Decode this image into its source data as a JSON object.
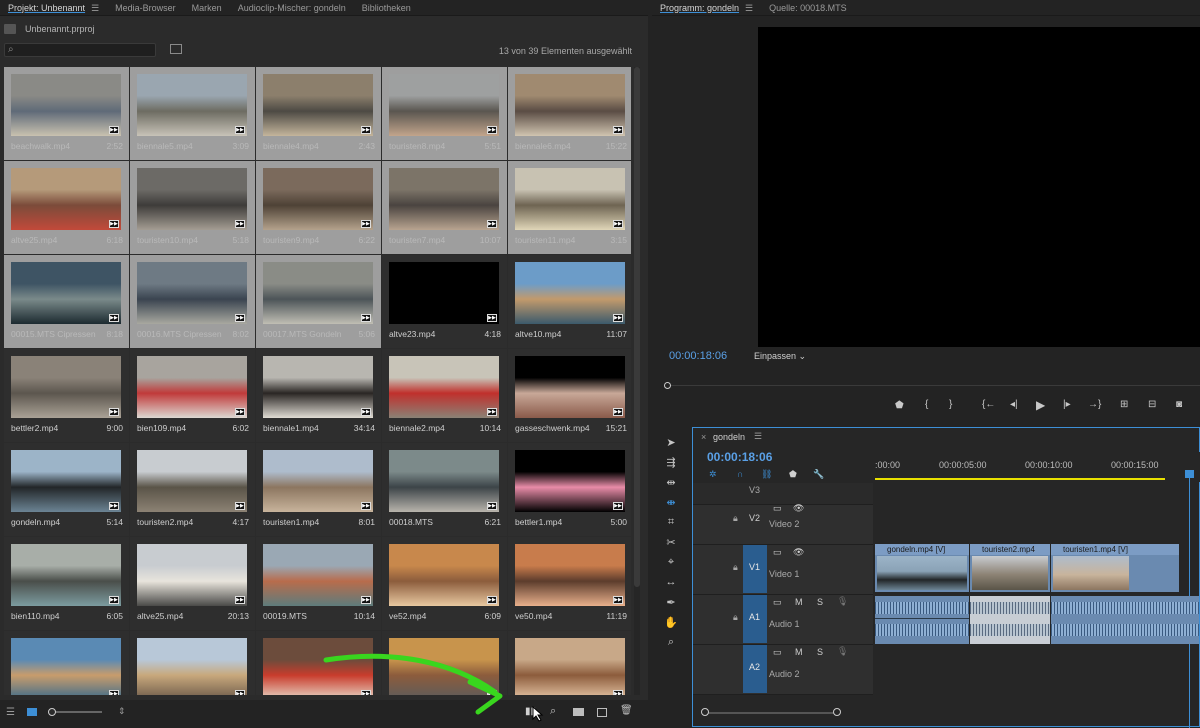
{
  "project_panel": {
    "tabs": [
      {
        "label": "Projekt: Unbenannt"
      },
      {
        "label": "Media-Browser"
      },
      {
        "label": "Marken"
      },
      {
        "label": "Audioclip-Mischer: gondeln"
      },
      {
        "label": "Bibliotheken"
      }
    ],
    "project_file": "Unbenannt.prproj",
    "search_placeholder": "",
    "selection_count": "13 von 39 Elementen ausgewählt",
    "items": [
      {
        "name": "beachwalk.mp4",
        "duration": "2:52",
        "selected": true,
        "thumb": [
          "#8a8a86",
          "#5f6a78",
          "#c9c2b0"
        ]
      },
      {
        "name": "biennale5.mp4",
        "duration": "3:09",
        "selected": true,
        "thumb": [
          "#9aa6b0",
          "#6d6c62",
          "#c8c3b8"
        ]
      },
      {
        "name": "biennale4.mp4",
        "duration": "2:43",
        "selected": true,
        "thumb": [
          "#8c7f6c",
          "#4d4a44",
          "#c4b59c"
        ]
      },
      {
        "name": "touristen8.mp4",
        "duration": "5:51",
        "selected": true,
        "thumb": [
          "#9ea0a0",
          "#5a5650",
          "#c2a58c"
        ]
      },
      {
        "name": "biennale6.mp4",
        "duration": "15:22",
        "selected": true,
        "thumb": [
          "#a08a70",
          "#5a4c44",
          "#d0c4b0"
        ]
      },
      {
        "name": "altve25.mp4",
        "duration": "6:18",
        "selected": true,
        "thumb": [
          "#b59a7a",
          "#7b4b3a",
          "#c24a3a"
        ]
      },
      {
        "name": "touristen10.mp4",
        "duration": "5:18",
        "selected": true,
        "thumb": [
          "#6c6a66",
          "#3e3c3a",
          "#a49d93"
        ]
      },
      {
        "name": "touristen9.mp4",
        "duration": "6:22",
        "selected": true,
        "thumb": [
          "#7b6a5c",
          "#4e4236",
          "#b4a28c"
        ]
      },
      {
        "name": "touristen7.mp4",
        "duration": "10:07",
        "selected": true,
        "thumb": [
          "#7c7468",
          "#4a4440",
          "#b8a490"
        ]
      },
      {
        "name": "touristen11.mp4",
        "duration": "3:15",
        "selected": true,
        "thumb": [
          "#c8c2b2",
          "#6e6452",
          "#e0d6b8"
        ]
      },
      {
        "name": "00015.MTS Cipressen",
        "duration": "8:18",
        "selected": true,
        "thumb": [
          "#3e5464",
          "#7a8a8a",
          "#1c2a30"
        ]
      },
      {
        "name": "00016.MTS Cipressen",
        "duration": "8:02",
        "selected": true,
        "thumb": [
          "#6e7a84",
          "#3a4450",
          "#a8a8a0"
        ]
      },
      {
        "name": "00017.MTS Gondeln",
        "duration": "5:06",
        "selected": true,
        "thumb": [
          "#8a8c86",
          "#4c5458",
          "#c0beb4"
        ]
      },
      {
        "name": "altve23.mp4",
        "duration": "4:18",
        "selected": false,
        "thumb": [
          "#000000",
          "#000000",
          "#000000"
        ]
      },
      {
        "name": "altve10.mp4",
        "duration": "11:07",
        "selected": false,
        "thumb": [
          "#6c9cc8",
          "#c29a6c",
          "#3c5a6c"
        ]
      },
      {
        "name": "bettler2.mp4",
        "duration": "9:00",
        "selected": false,
        "thumb": [
          "#8a8278",
          "#5c564e",
          "#aaa296"
        ]
      },
      {
        "name": "bien109.mp4",
        "duration": "6:02",
        "selected": false,
        "thumb": [
          "#a8a49e",
          "#c03a3a",
          "#dcd8d2"
        ]
      },
      {
        "name": "biennale1.mp4",
        "duration": "34:14",
        "selected": false,
        "thumb": [
          "#b8b6b0",
          "#2a2624",
          "#e0dcd4"
        ]
      },
      {
        "name": "biennale2.mp4",
        "duration": "10:14",
        "selected": false,
        "thumb": [
          "#c8c4b8",
          "#c0302c",
          "#8a8276"
        ]
      },
      {
        "name": "gasseschwenk.mp4",
        "duration": "15:21",
        "selected": false,
        "thumb": [
          "#000000",
          "#c8a898",
          "#8a5a4a"
        ]
      },
      {
        "name": "gondeln.mp4",
        "duration": "5:14",
        "selected": false,
        "thumb": [
          "#9cb4c8",
          "#222628",
          "#6c8494"
        ]
      },
      {
        "name": "touristen2.mp4",
        "duration": "4:17",
        "selected": false,
        "thumb": [
          "#c8ccd0",
          "#5a5448",
          "#8c8274"
        ]
      },
      {
        "name": "touristen1.mp4",
        "duration": "8:01",
        "selected": false,
        "thumb": [
          "#aebccc",
          "#8c7660",
          "#c8b49c"
        ]
      },
      {
        "name": "00018.MTS",
        "duration": "6:21",
        "selected": false,
        "thumb": [
          "#7c8a8a",
          "#3c4448",
          "#b8b4ac"
        ]
      },
      {
        "name": "bettler1.mp4",
        "duration": "5:00",
        "selected": false,
        "thumb": [
          "#000000",
          "#e88ca8",
          "#000000"
        ]
      },
      {
        "name": "bien110.mp4",
        "duration": "6:05",
        "selected": false,
        "thumb": [
          "#a8aea8",
          "#4a4e4a",
          "#7c9ca0"
        ]
      },
      {
        "name": "altve25.mp4",
        "duration": "20:13",
        "selected": false,
        "thumb": [
          "#c8ccd0",
          "#e8e4dc",
          "#4a4a48"
        ]
      },
      {
        "name": "00019.MTS",
        "duration": "10:14",
        "selected": false,
        "thumb": [
          "#9aa8b4",
          "#b86c4c",
          "#5e7c7c"
        ]
      },
      {
        "name": "ve52.mp4",
        "duration": "6:09",
        "selected": false,
        "thumb": [
          "#c8884c",
          "#8c5c3c",
          "#e8c8a0"
        ]
      },
      {
        "name": "ve50.mp4",
        "duration": "11:19",
        "selected": false,
        "thumb": [
          "#c87c4c",
          "#5c3c2c",
          "#e8b08c"
        ]
      },
      {
        "name": "",
        "duration": "",
        "selected": false,
        "thumb": [
          "#5a8ab4",
          "#c89c6c",
          "#3c6c8c"
        ]
      },
      {
        "name": "",
        "duration": "",
        "selected": false,
        "thumb": [
          "#b8c8d8",
          "#c8a87c",
          "#6c5a4a"
        ]
      },
      {
        "name": "",
        "duration": "",
        "selected": false,
        "thumb": [
          "#6c4c3c",
          "#c83c2c",
          "#e8d8c8"
        ]
      },
      {
        "name": "",
        "duration": "",
        "selected": false,
        "thumb": [
          "#c8944c",
          "#8c5c3c",
          "#5c5c5c"
        ]
      },
      {
        "name": "",
        "duration": "",
        "selected": false,
        "thumb": [
          "#c8a888",
          "#8c5c3c",
          "#e8c8a8"
        ]
      }
    ]
  },
  "program_monitor": {
    "tabs": [
      {
        "label": "Programm: gondeln"
      },
      {
        "label": "Quelle: 00018.MTS"
      }
    ],
    "timecode": "00:00:18:06",
    "fit_select": "Einpassen"
  },
  "timeline": {
    "sequence_name": "gondeln",
    "timecode": "00:00:18:06",
    "ruler_labels": [
      ":00:00",
      "00:00:05:00",
      "00:00:10:00",
      "00:00:15:00"
    ],
    "tracks": {
      "v3": "V3",
      "v2": {
        "id": "V2",
        "name": "Video 2"
      },
      "v1": {
        "id": "V1",
        "name": "Video 1"
      },
      "a1": {
        "id": "A1",
        "name": "Audio 1"
      },
      "a2": {
        "id": "A2",
        "name": "Audio 2"
      },
      "m": "M",
      "s": "S"
    },
    "clips": [
      {
        "label": "gondeln.mp4 [V]"
      },
      {
        "label": "touristen2.mp4"
      },
      {
        "label": "touristen1.mp4 [V]"
      }
    ]
  },
  "colors": {
    "accent": "#3d8fd6",
    "timecode": "#5aa0e6",
    "annotation_arrow": "#39d61e"
  }
}
